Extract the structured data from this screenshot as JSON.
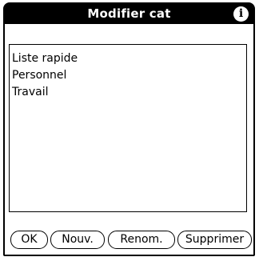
{
  "dialog": {
    "title": "Modifier cat",
    "info_icon": "info-icon",
    "info_glyph": "i"
  },
  "categories": [
    "Liste rapide",
    "Personnel",
    "Travail"
  ],
  "buttons": {
    "ok": "OK",
    "new": "Nouv.",
    "rename": "Renom.",
    "delete": "Supprimer"
  }
}
